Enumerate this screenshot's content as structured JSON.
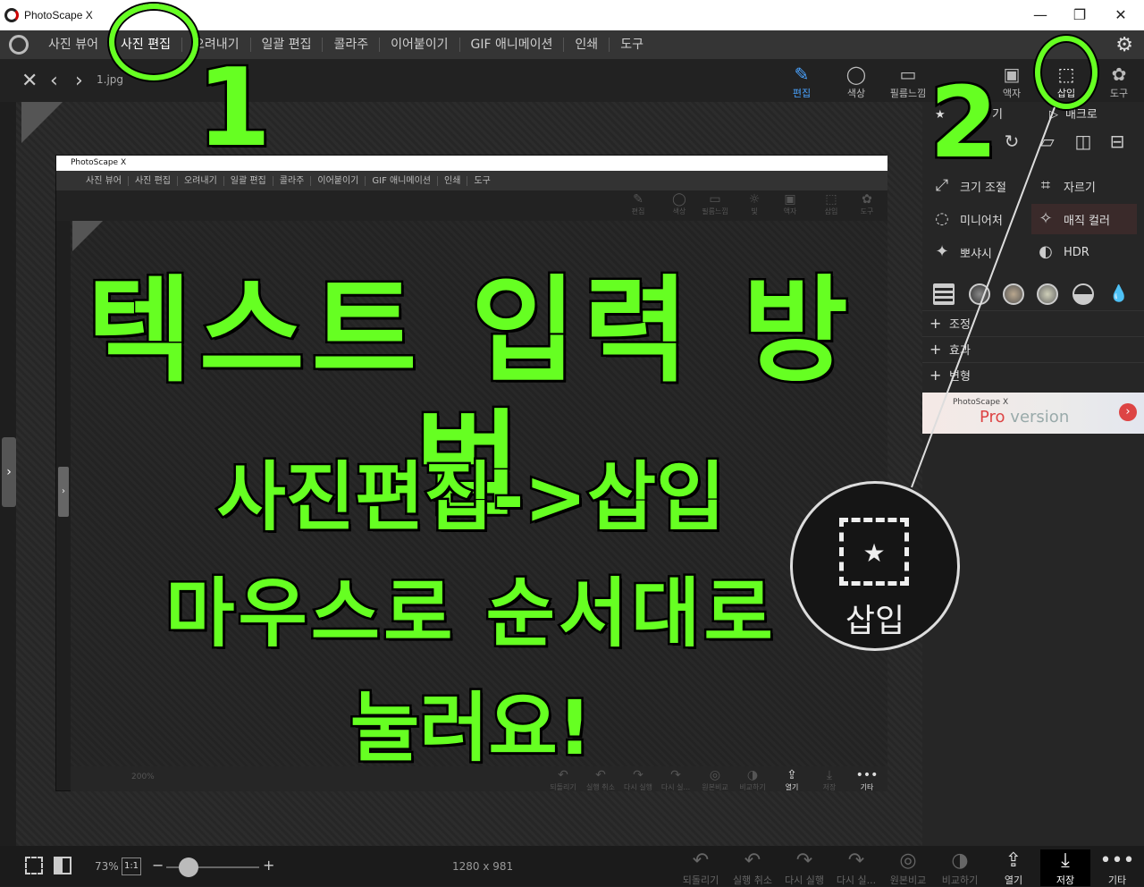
{
  "window": {
    "title": "PhotoScape X",
    "controls": [
      "—",
      "❐",
      "✕"
    ]
  },
  "menu": {
    "items": [
      "사진 뷰어",
      "사진 편집",
      "오려내기",
      "일괄 편집",
      "콜라주",
      "이어붙이기",
      "GIF 애니메이션",
      "인쇄",
      "도구"
    ],
    "active": "사진 편집"
  },
  "toolbar": {
    "filename": "1.jpg",
    "tools": [
      {
        "label": "편집",
        "icon": "✎"
      },
      {
        "label": "색상",
        "icon": "◯"
      },
      {
        "label": "필름느낌",
        "icon": "▭"
      },
      {
        "label": "액자",
        "icon": "▣"
      },
      {
        "label": "삽입",
        "icon": "⬚"
      },
      {
        "label": "도구",
        "icon": "✿"
      }
    ]
  },
  "right_panel": {
    "tabs": [
      "기",
      "매크로"
    ],
    "items": [
      {
        "label": "크기 조절",
        "icon": "⤢"
      },
      {
        "label": "자르기",
        "icon": "⌗"
      },
      {
        "label": "미니어처",
        "icon": "◌"
      },
      {
        "label": "매직 컬러",
        "icon": "✧"
      },
      {
        "label": "뽀샤시",
        "icon": "✦"
      },
      {
        "label": "HDR",
        "icon": "◐"
      }
    ],
    "sections": [
      "조정",
      "효과",
      "변형"
    ],
    "ad": {
      "small": "PhotoScape X",
      "pro": "Pro",
      "version": "version"
    }
  },
  "inner_screenshot": {
    "title": "PhotoScape X",
    "menu": [
      "사진 뷰어",
      "사진 편집",
      "오려내기",
      "일괄 편집",
      "콜라주",
      "이어붙이기",
      "GIF 애니메이션",
      "인쇄",
      "도구"
    ],
    "tools": [
      "편집",
      "색상",
      "필름느낌",
      "빛",
      "액자",
      "삽입",
      "도구"
    ],
    "bottom": [
      "되돌리기",
      "실행 취소",
      "다시 실행",
      "다시 실...",
      "원본비교",
      "비교하기",
      "열기",
      "저장",
      "기타"
    ],
    "zoom": "200%"
  },
  "bottombar": {
    "zoom": "73%",
    "one_to_one": "1:1",
    "dims": "1280 x 981",
    "buttons": [
      {
        "label": "되돌리기",
        "icon": "↶"
      },
      {
        "label": "실행 취소",
        "icon": "↶"
      },
      {
        "label": "다시 실행",
        "icon": "↷"
      },
      {
        "label": "다시 실...",
        "icon": "↷"
      },
      {
        "label": "원본비교",
        "icon": "◎"
      },
      {
        "label": "비교하기",
        "icon": "◑"
      },
      {
        "label": "열기",
        "icon": "⇪"
      },
      {
        "label": "저장",
        "icon": "⤓"
      },
      {
        "label": "기타",
        "icon": "•••"
      }
    ]
  },
  "overlay": {
    "step1": "1",
    "step2": "2",
    "headline": "텍스트 입력 방법",
    "line1": "사진편집->삽입",
    "line2": "마우스로 순서대로",
    "line3": "눌러요!",
    "zoom_label": "삽입",
    "zoom_star": "★"
  },
  "colors": {
    "accent_green": "#66ff22",
    "active_tool_blue": "#4aa3ff"
  }
}
